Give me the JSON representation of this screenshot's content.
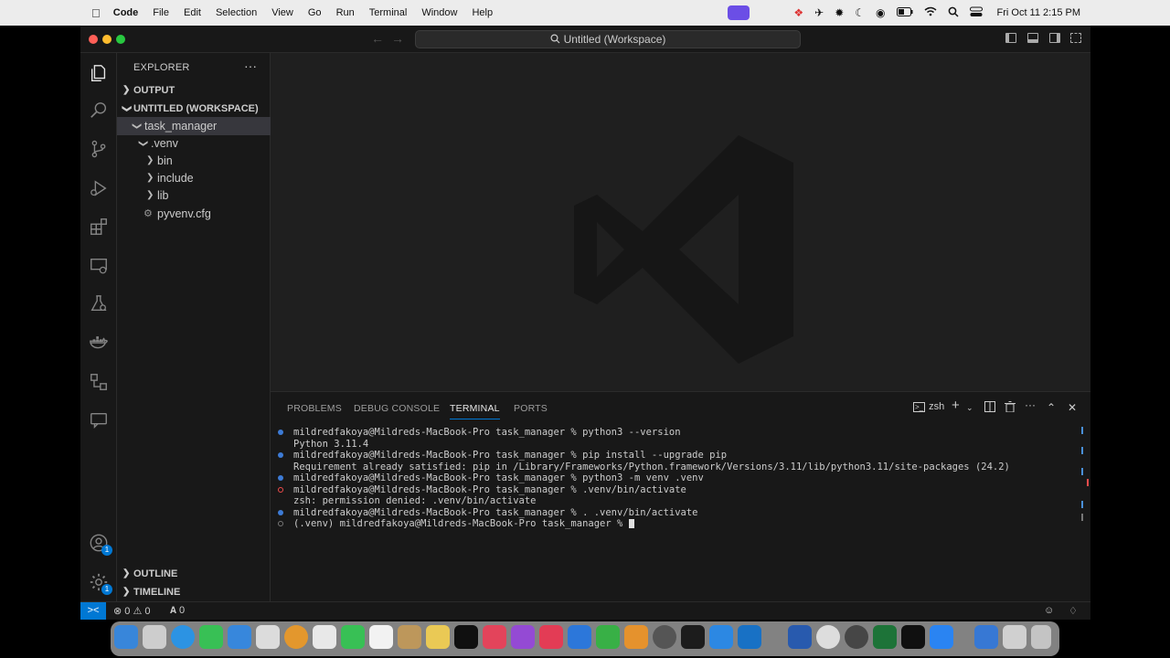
{
  "menubar": {
    "apple": "",
    "app_name": "Code",
    "items": [
      "File",
      "Edit",
      "Selection",
      "View",
      "Go",
      "Run",
      "Terminal",
      "Window",
      "Help"
    ],
    "clock": "Fri Oct 11  2:15 PM"
  },
  "window": {
    "title": "Untitled (Workspace)"
  },
  "sidebar": {
    "title": "EXPLORER",
    "more": "···",
    "sections": {
      "output": "OUTPUT",
      "workspace": "UNTITLED (WORKSPACE)",
      "outline": "OUTLINE",
      "timeline": "TIMELINE"
    },
    "tree": [
      {
        "label": "task_manager",
        "expanded": true,
        "selected": true
      },
      {
        "label": ".venv",
        "expanded": true
      },
      {
        "label": "bin",
        "expanded": false
      },
      {
        "label": "include",
        "expanded": false
      },
      {
        "label": "lib",
        "expanded": false
      },
      {
        "label": "pyvenv.cfg",
        "file": true
      }
    ]
  },
  "activity": {
    "accounts_badge": "1",
    "settings_badge": "1"
  },
  "panel": {
    "tabs": [
      "PROBLEMS",
      "DEBUG CONSOLE",
      "TERMINAL",
      "PORTS"
    ],
    "active_tab": "TERMINAL",
    "shell": "zsh",
    "terminal_lines": [
      {
        "status": "ok",
        "text": "mildredfakoya@Mildreds-MacBook-Pro task_manager % python3 --version"
      },
      {
        "status": "none",
        "text": "Python 3.11.4"
      },
      {
        "status": "ok",
        "text": "mildredfakoya@Mildreds-MacBook-Pro task_manager % pip install --upgrade pip"
      },
      {
        "status": "none",
        "text": "Requirement already satisfied: pip in /Library/Frameworks/Python.framework/Versions/3.11/lib/python3.11/site-packages (24.2)"
      },
      {
        "status": "ok",
        "text": "mildredfakoya@Mildreds-MacBook-Pro task_manager % python3 -m venv .venv"
      },
      {
        "status": "err",
        "text": "mildredfakoya@Mildreds-MacBook-Pro task_manager % .venv/bin/activate"
      },
      {
        "status": "none",
        "text": "zsh: permission denied: .venv/bin/activate"
      },
      {
        "status": "ok",
        "text": "mildredfakoya@Mildreds-MacBook-Pro task_manager % . .venv/bin/activate"
      },
      {
        "status": "idle",
        "text": "(.venv) mildredfakoya@Mildreds-MacBook-Pro task_manager % "
      }
    ]
  },
  "statusbar": {
    "remote": "><",
    "errors": "0",
    "warnings": "0",
    "ports": "0"
  },
  "colors": {
    "accent": "#0078d4",
    "error": "#f14c4c"
  }
}
